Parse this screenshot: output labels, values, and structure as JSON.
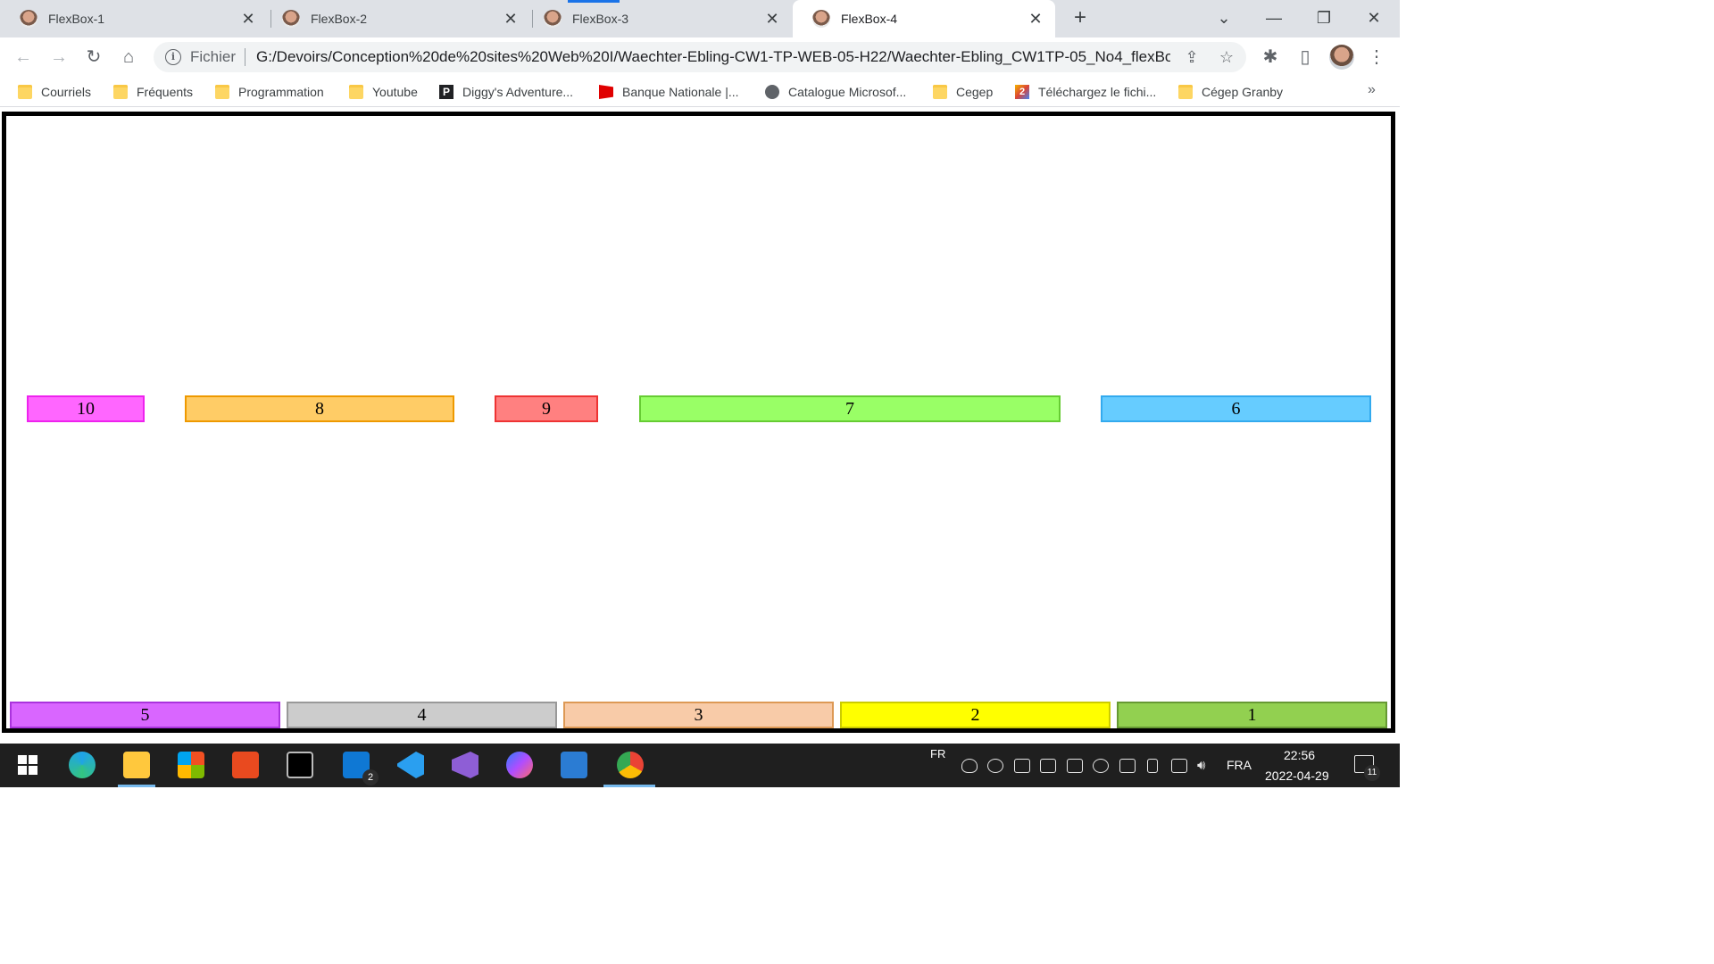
{
  "browser": {
    "tabs": [
      {
        "title": "FlexBox-1",
        "active": false
      },
      {
        "title": "FlexBox-2",
        "active": false
      },
      {
        "title": "FlexBox-3",
        "active": false
      },
      {
        "title": "FlexBox-4",
        "active": true
      }
    ],
    "new_tab_glyph": "+",
    "close_glyph": "✕",
    "window_controls": {
      "minimize": "—",
      "restore": "❐",
      "close": "✕",
      "tab_search": "⌄"
    },
    "toolbar": {
      "back": "←",
      "forward": "→",
      "reload": "↻",
      "home": "⌂",
      "menu": "⋮"
    },
    "omnibox": {
      "info_glyph": "i",
      "scheme_label": "Fichier",
      "url": "G:/Devoirs/Conception%20de%20sites%20Web%20I/Waechter-Ebling-CW1-TP-WEB-05-H22/Waechter-Ebling_CW1TP-05_No4_flexBo...",
      "share_glyph": "⇪",
      "star_glyph": "☆"
    },
    "extensions_glyph": "✱",
    "sidepanel_glyph": "▯",
    "bookmarks": [
      {
        "label": "Courriels",
        "icon": "folder-icon"
      },
      {
        "label": "Fréquents",
        "icon": "folder-icon"
      },
      {
        "label": "Programmation",
        "icon": "folder-icon"
      },
      {
        "label": "Youtube",
        "icon": "folder-icon"
      },
      {
        "label": "Diggy's Adventure...",
        "icon": "p-icon",
        "glyph": "P"
      },
      {
        "label": "Banque Nationale |...",
        "icon": "flag-icon"
      },
      {
        "label": "Catalogue Microsof...",
        "icon": "globe-icon"
      },
      {
        "label": "Cegep",
        "icon": "folder-icon"
      },
      {
        "label": "Téléchargez le fichi...",
        "icon": "two-icon",
        "glyph": "2"
      },
      {
        "label": "Cégep Granby",
        "icon": "folder-icon"
      }
    ],
    "bookmarks_more": "»"
  },
  "page": {
    "border_color": "#000000",
    "middle_row": [
      {
        "label": "10",
        "bg": "#ff66ff",
        "border": "#ee22ee"
      },
      {
        "label": "8",
        "bg": "#ffcc66",
        "border": "#ee9900"
      },
      {
        "label": "9",
        "bg": "#ff8080",
        "border": "#ee3333"
      },
      {
        "label": "7",
        "bg": "#99ff66",
        "border": "#66cc33"
      },
      {
        "label": "6",
        "bg": "#66ccff",
        "border": "#33aaee"
      }
    ],
    "bottom_row": [
      {
        "label": "5",
        "bg": "#d966ff",
        "border": "#aa33dd"
      },
      {
        "label": "4",
        "bg": "#cccccc",
        "border": "#999999"
      },
      {
        "label": "3",
        "bg": "#f8cba8",
        "border": "#dd9955"
      },
      {
        "label": "2",
        "bg": "#ffff00",
        "border": "#cccc00"
      },
      {
        "label": "1",
        "bg": "#92d050",
        "border": "#669933"
      }
    ]
  },
  "taskbar": {
    "apps": [
      {
        "name": "windows-start-icon",
        "color": "#ffffff"
      },
      {
        "name": "edge-icon",
        "color": "#1fa3e8"
      },
      {
        "name": "file-explorer-icon",
        "color": "#ffc83d"
      },
      {
        "name": "microsoft-store-icon",
        "color": "#f25022"
      },
      {
        "name": "office-icon",
        "color": "#e94a1f"
      },
      {
        "name": "terminal-icon",
        "color": "#000000"
      },
      {
        "name": "outlook-icon",
        "color": "#0f78d4",
        "badge": "2"
      },
      {
        "name": "vscode-icon",
        "color": "#2a9ff0"
      },
      {
        "name": "visual-studio-icon",
        "color": "#8e5ed6"
      },
      {
        "name": "messenger-icon",
        "color": "#8a6cff"
      },
      {
        "name": "word-icon",
        "color": "#2b7cd3"
      },
      {
        "name": "chrome-icon",
        "color": "#4caf50"
      }
    ],
    "input_indicator": "FR",
    "language": "FRA",
    "time": "22:56",
    "date": "2022-04-29",
    "notifications_count": "11"
  }
}
